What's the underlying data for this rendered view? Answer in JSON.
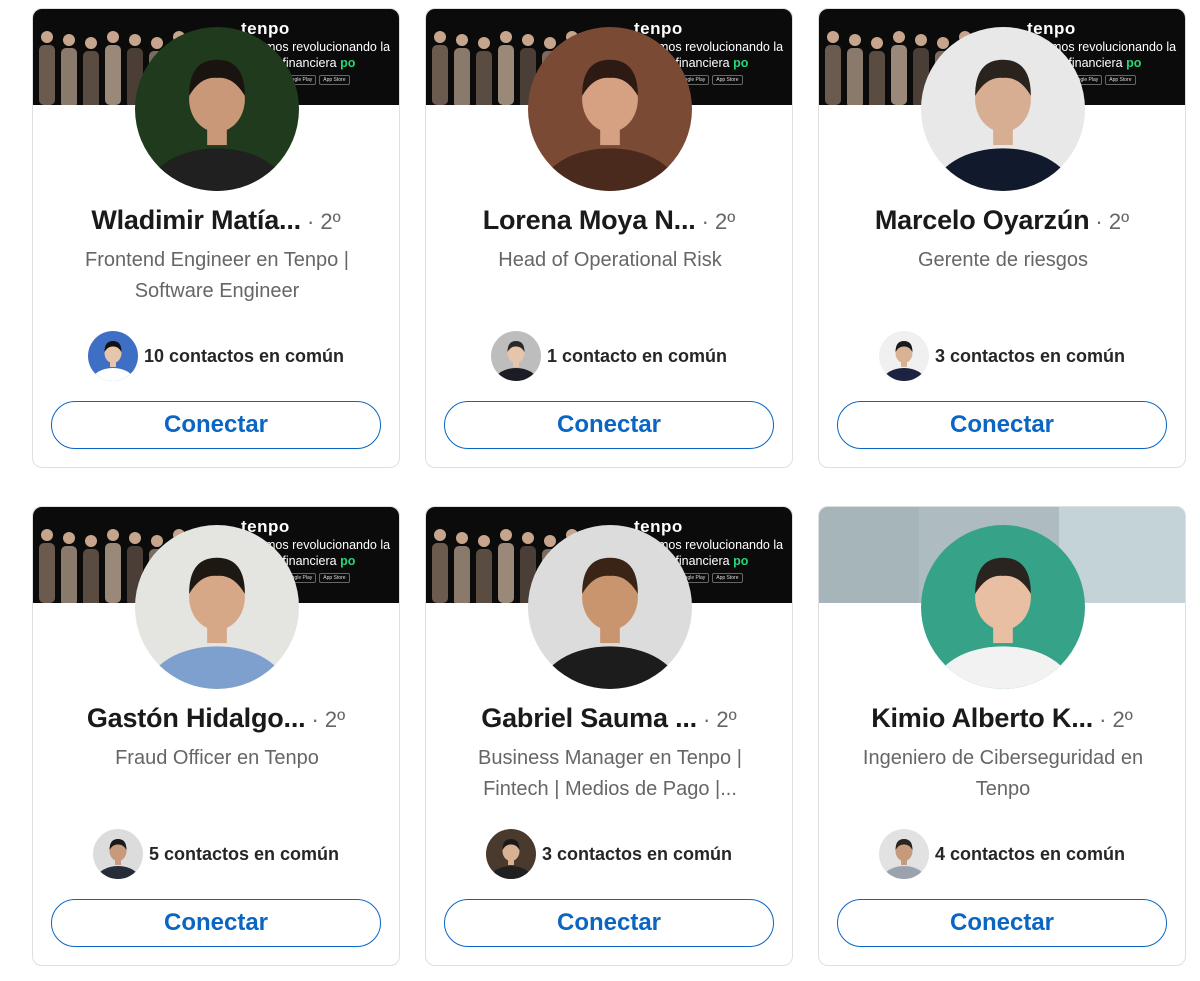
{
  "banner": {
    "brand": "tenpo",
    "tagline_main": "mos revolucionando la",
    "tagline_second": "ria financiera",
    "tagline_mark": "po",
    "store_google": "Google Play",
    "store_apple": "App Store"
  },
  "cards": [
    {
      "name": "Wladimir Matía...",
      "degree": "· 2º",
      "headline": "Frontend Engineer en Tenpo | Software Engineer",
      "mutual": "10 contactos en común",
      "connect_label": "Conectar",
      "banner": "tenpo",
      "avatar_colors": {
        "bg": "#1f3a1c",
        "skin": "#c89878",
        "hair": "#1a1410",
        "shirt": "#202020"
      },
      "mutual_colors": {
        "bg": "#3d6fc4",
        "skin": "#e6c5ad",
        "hair": "#121212",
        "shirt": "#ffffff"
      }
    },
    {
      "name": "Lorena Moya N...",
      "degree": "· 2º",
      "headline": "Head of Operational Risk",
      "mutual": "1 contacto en común",
      "connect_label": "Conectar",
      "banner": "tenpo",
      "avatar_colors": {
        "bg": "#7a4a34",
        "skin": "#d6a082",
        "hair": "#2d1a12",
        "shirt": "#4a2a1c"
      },
      "mutual_colors": {
        "bg": "#bdbdbd",
        "skin": "#e6c5ad",
        "hair": "#2a2a2a",
        "shirt": "#1c1c24"
      }
    },
    {
      "name": "Marcelo Oyarzún",
      "degree": "· 2º",
      "headline": "Gerente de riesgos",
      "mutual": "3 contactos en común",
      "connect_label": "Conectar",
      "banner": "tenpo",
      "avatar_colors": {
        "bg": "#e8e8e8",
        "skin": "#d8ae92",
        "hair": "#2a221c",
        "shirt": "#111a2c"
      },
      "mutual_colors": {
        "bg": "#f0f0f0",
        "skin": "#d9b294",
        "hair": "#1a1a1a",
        "shirt": "#1c2240"
      }
    },
    {
      "name": "Gastón Hidalgo...",
      "degree": "· 2º",
      "headline": "Fraud Officer en Tenpo",
      "mutual": "5 contactos en común",
      "connect_label": "Conectar",
      "banner": "tenpo",
      "avatar_colors": {
        "bg": "#e4e4e0",
        "skin": "#d6a888",
        "hair": "#1e1812",
        "shirt": "#7ea0cf"
      },
      "mutual_colors": {
        "bg": "#dcdcdc",
        "skin": "#c89a7c",
        "hair": "#1a1a1a",
        "shirt": "#262c38"
      }
    },
    {
      "name": "Gabriel Sauma ...",
      "degree": "· 2º",
      "headline": "Business Manager en Tenpo | Fintech | Medios de Pago |...",
      "mutual": "3 contactos en común",
      "connect_label": "Conectar",
      "banner": "tenpo",
      "avatar_colors": {
        "bg": "#dcdcdc",
        "skin": "#c9956f",
        "hair": "#3a2416",
        "shirt": "#1c1c1c"
      },
      "mutual_colors": {
        "bg": "#4a3a2e",
        "skin": "#d9b294",
        "hair": "#1a1a1a",
        "shirt": "#202020"
      }
    },
    {
      "name": "Kimio Alberto K...",
      "degree": "· 2º",
      "headline": "Ingeniero de Ciberseguridad en Tenpo",
      "mutual": "4 contactos en común",
      "connect_label": "Conectar",
      "banner": "plain",
      "avatar_colors": {
        "bg": "#36a389",
        "skin": "#e8bfa2",
        "hair": "#2a2420",
        "shirt": "#f2f2f2"
      },
      "mutual_colors": {
        "bg": "#e2e2e2",
        "skin": "#c89a7c",
        "hair": "#2a2420",
        "shirt": "#9aa3ad"
      }
    }
  ],
  "colors": {
    "accent": "#0a66c2",
    "name": "#1a1a1a",
    "muted": "#666666",
    "card_border": "#dfdfdf"
  }
}
